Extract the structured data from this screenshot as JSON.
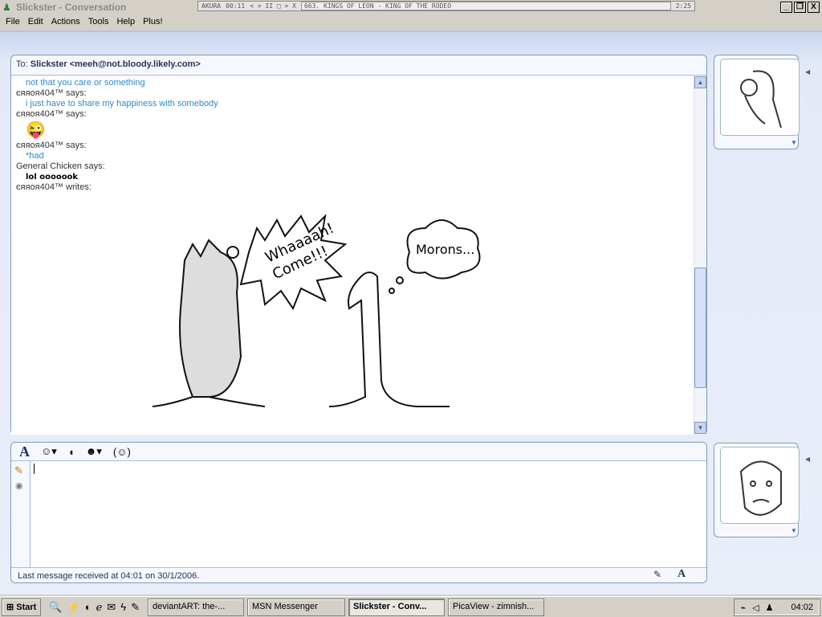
{
  "window": {
    "title": "Slickster - Conversation",
    "min": "_",
    "max": "❐",
    "close": "X"
  },
  "player": {
    "name": "AKURA",
    "time": "00:11",
    "controls": "< > II □ > X",
    "track": "663. KINGS OF LEON - KING OF THE RODEO",
    "track_time": "2:25"
  },
  "menu": [
    "File",
    "Edit",
    "Actions",
    "Tools",
    "Help",
    "Plus!"
  ],
  "to": {
    "label": "To:",
    "name": "Slickster",
    "email": "<meeh@not.bloody.likely.com>"
  },
  "messages": [
    {
      "type": "txt",
      "text": "not that you care or something"
    },
    {
      "type": "who",
      "text": "єяяоя404™ says:"
    },
    {
      "type": "txt",
      "text": "i just have to share my happiness with somebody"
    },
    {
      "type": "who",
      "text": "єяяоя404™ says:"
    },
    {
      "type": "emoticon",
      "text": ""
    },
    {
      "type": "who",
      "text": "єяяоя404™ says:"
    },
    {
      "type": "txt",
      "text": "*had"
    },
    {
      "type": "who",
      "text": "General Chicken says:"
    },
    {
      "type": "bold",
      "text": "lol ooooook"
    },
    {
      "type": "who",
      "text": "єяяоя404™ writes:"
    }
  ],
  "ink": {
    "bubble1": "Whaaaah!",
    "bubble2": "Come!!!",
    "thought": "Morons..."
  },
  "status": "Last message received at 04:01 on 30/1/2006.",
  "taskbar": {
    "start": "Start",
    "items": [
      "deviantART: the-...",
      "MSN Messenger",
      "Slickster - Conv...",
      "PicaView - zimnish..."
    ],
    "active": 2,
    "clock": "04:02"
  },
  "colors": {
    "accent": "#2c8ad0",
    "border": "#7f9db9"
  }
}
